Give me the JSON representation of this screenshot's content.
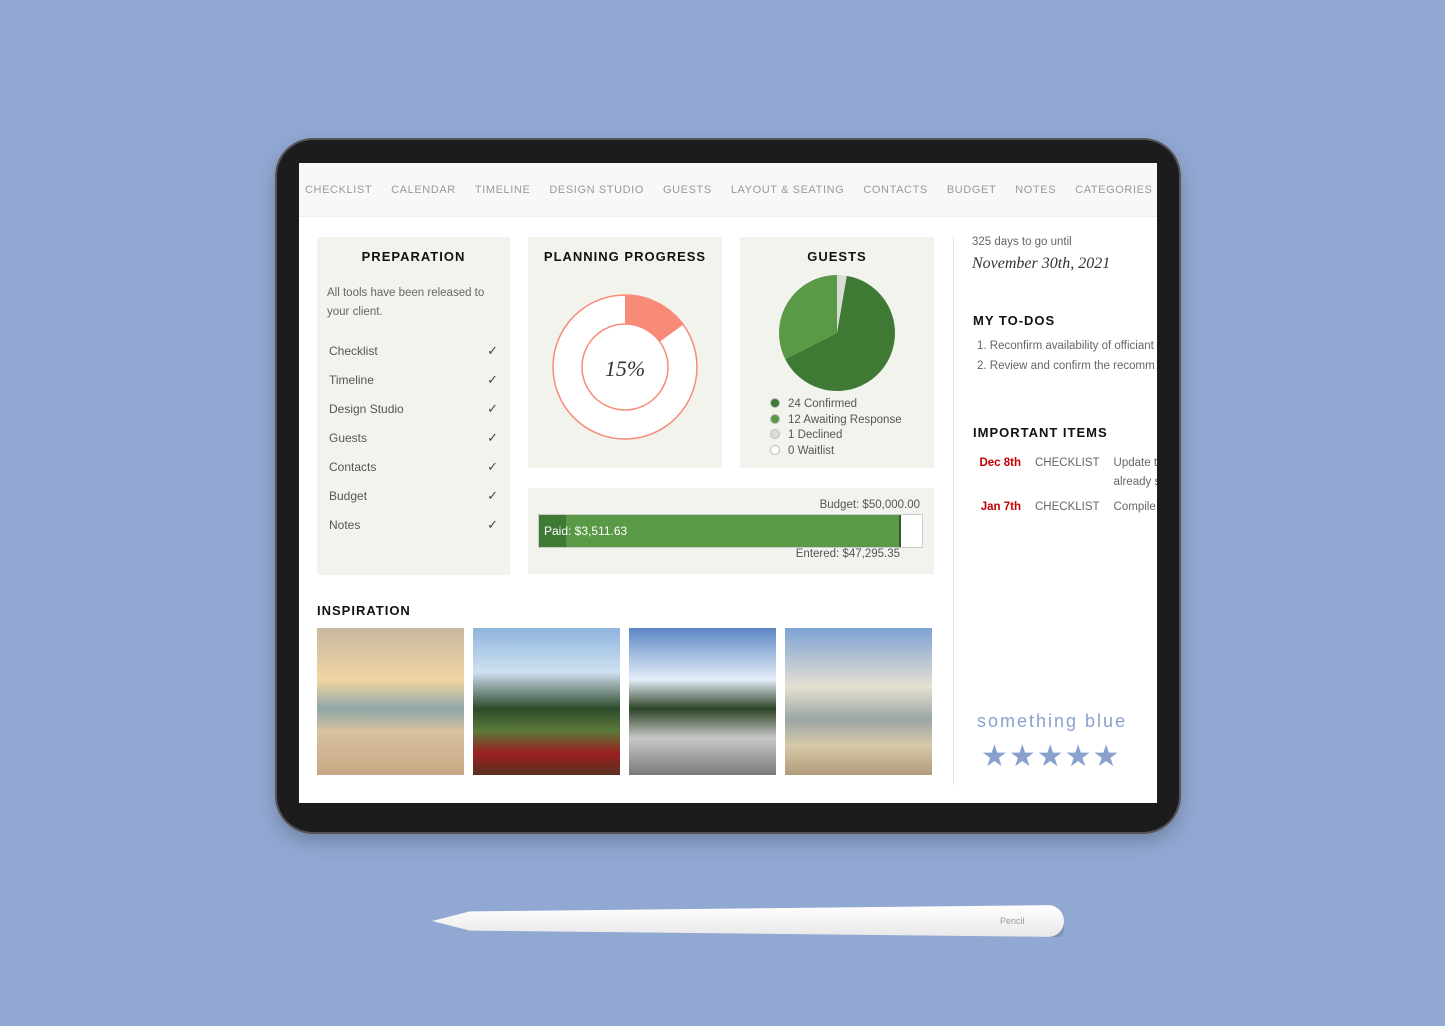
{
  "nav": [
    "CHECKLIST",
    "CALENDAR",
    "TIMELINE",
    "DESIGN STUDIO",
    "GUESTS",
    "LAYOUT & SEATING",
    "CONTACTS",
    "BUDGET",
    "NOTES",
    "CATEGORIES"
  ],
  "preparation": {
    "title": "PREPARATION",
    "note": "All tools have been released to your client.",
    "items": [
      "Checklist",
      "Timeline",
      "Design Studio",
      "Guests",
      "Contacts",
      "Budget",
      "Notes"
    ]
  },
  "progress": {
    "title": "PLANNING PROGRESS",
    "label": "15%",
    "value": 15,
    "color": "#f88a78"
  },
  "guests": {
    "title": "GUESTS",
    "legend": [
      {
        "label": "24 Confirmed",
        "count": 24,
        "color": "#3f7a35"
      },
      {
        "label": "12 Awaiting Response",
        "count": 12,
        "color": "#5a9a46"
      },
      {
        "label": "1 Declined",
        "count": 1,
        "color": "#dcdcd6"
      },
      {
        "label": "0 Waitlist",
        "count": 0,
        "color": "#ffffff"
      }
    ]
  },
  "budget": {
    "budget_label": "Budget: $50,000.00",
    "paid_label": "Paid: $3,511.63",
    "entered_label": "Entered: $47,295.35",
    "budget": 50000,
    "paid": 3511.63,
    "entered": 47295.35
  },
  "inspiration": {
    "title": "INSPIRATION"
  },
  "countdown": {
    "days": "325 days to go until",
    "date": "November 30th, 2021"
  },
  "todos": {
    "title": "MY TO-DOS",
    "items": [
      "1. Reconfirm availability of officiant",
      "2. Review and confirm the recomm"
    ]
  },
  "important": {
    "title": "IMPORTANT ITEMS",
    "items": [
      {
        "date": "Dec 8th",
        "cat": "CHECKLIST",
        "text": "Update th",
        "text2": "already sc"
      },
      {
        "date": "Jan 7th",
        "cat": "CHECKLIST",
        "text": "Compile th"
      }
    ]
  },
  "brand": {
    "name": "something blue",
    "rating": 5
  },
  "pencil": {
    "label": "Pencil"
  }
}
